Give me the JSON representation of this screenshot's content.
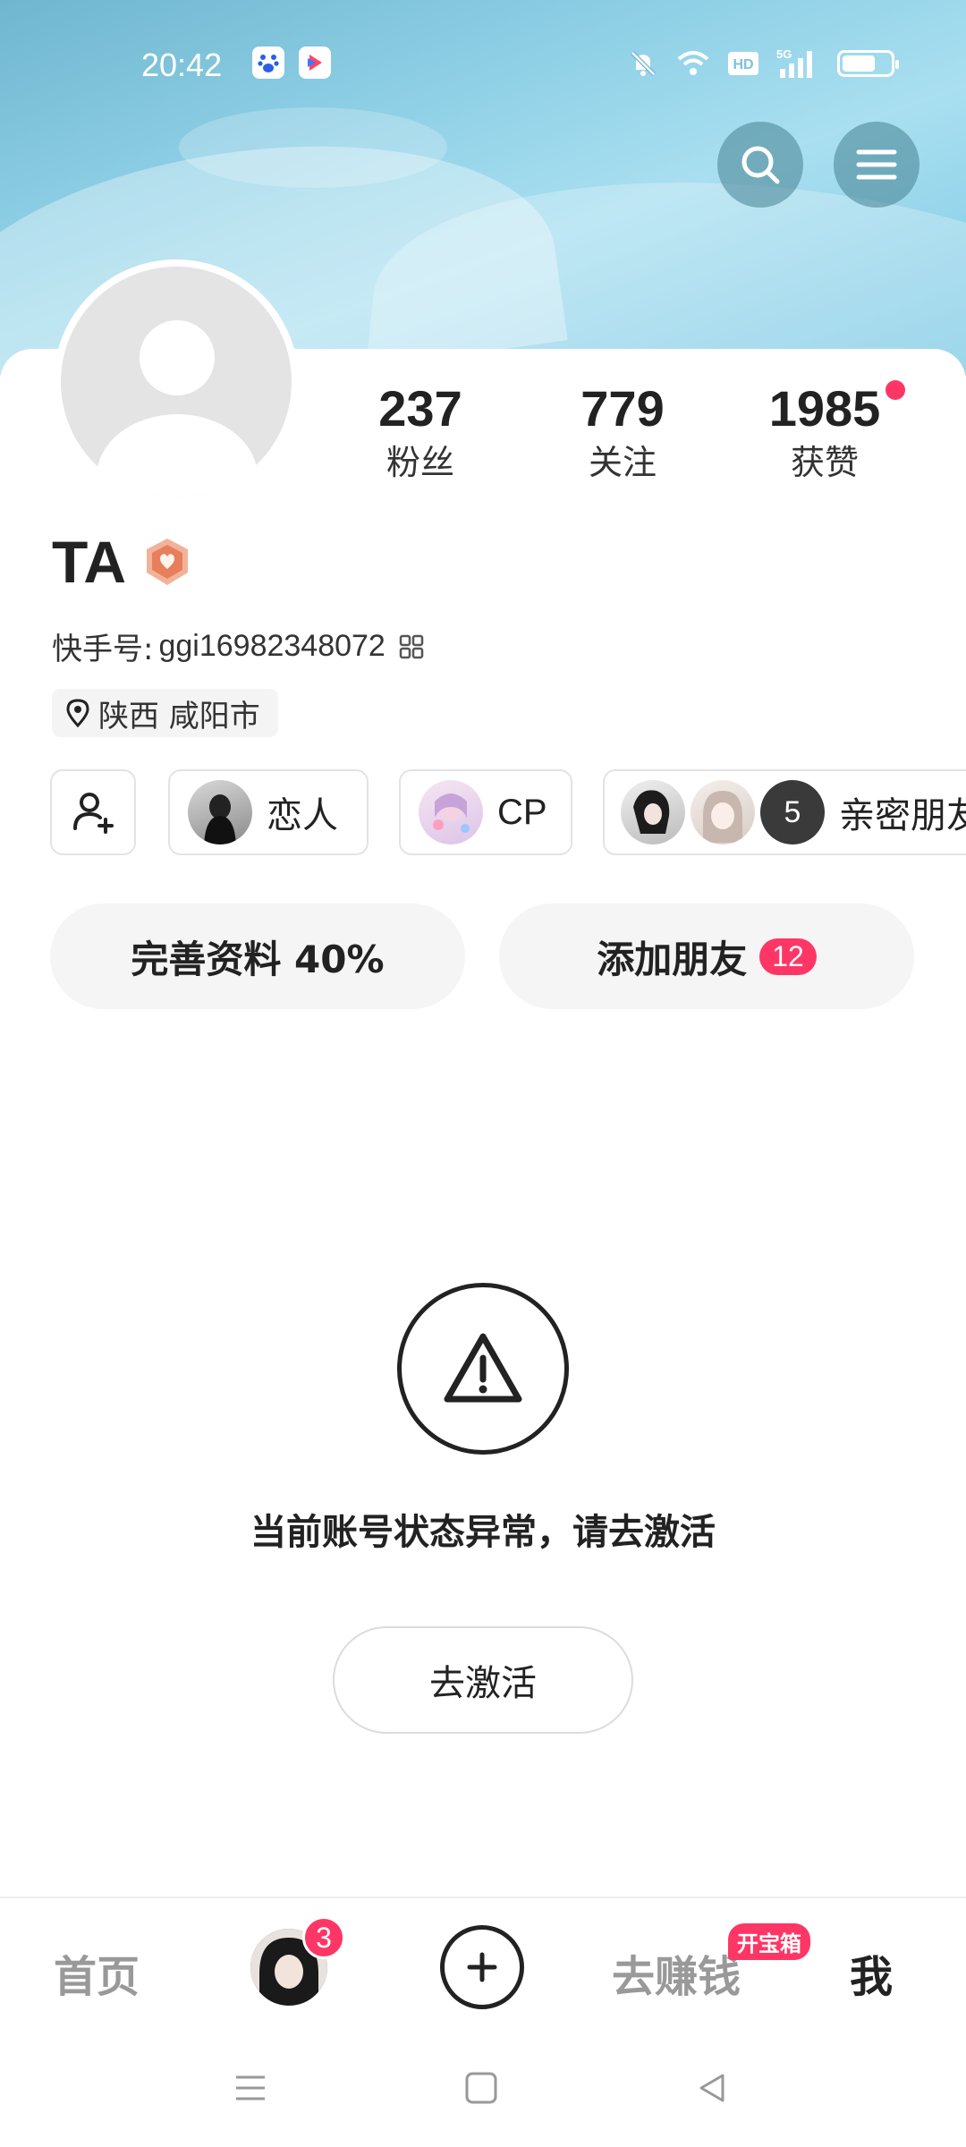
{
  "status_bar": {
    "time": "20:42",
    "network": "5G",
    "hd": "HD",
    "battery_percent": 70,
    "icons": [
      "baidu-app-icon",
      "video-app-icon",
      "mute-icon",
      "wifi-icon",
      "hd-icon",
      "signal-icon",
      "battery-icon"
    ]
  },
  "header": {
    "search_icon": "search-icon",
    "menu_icon": "menu-icon"
  },
  "profile": {
    "stats": [
      {
        "value": "237",
        "label": "粉丝"
      },
      {
        "value": "779",
        "label": "关注"
      },
      {
        "value": "1985",
        "label": "获赞"
      }
    ],
    "name": "TA",
    "kuaishou_id_label": "快手号:",
    "kuaishou_id": "ggi16982348072",
    "location": "陕西 咸阳市"
  },
  "relations": [
    {
      "label": "恋人"
    },
    {
      "label": "CP"
    },
    {
      "label": "亲密朋友",
      "count": "5"
    }
  ],
  "actions": {
    "complete_profile": "完善资料 40%",
    "add_friends": "添加朋友",
    "add_friends_count": "12"
  },
  "notice": {
    "message": "当前账号状态异常，请去激活",
    "button": "去激活"
  },
  "bottom_nav": {
    "home": "首页",
    "messages_badge": "3",
    "earn": "去赚钱",
    "earn_badge": "开宝箱",
    "me": "我"
  },
  "colors": {
    "accent": "#fe3666",
    "header_bg": "#8fd0e6"
  }
}
